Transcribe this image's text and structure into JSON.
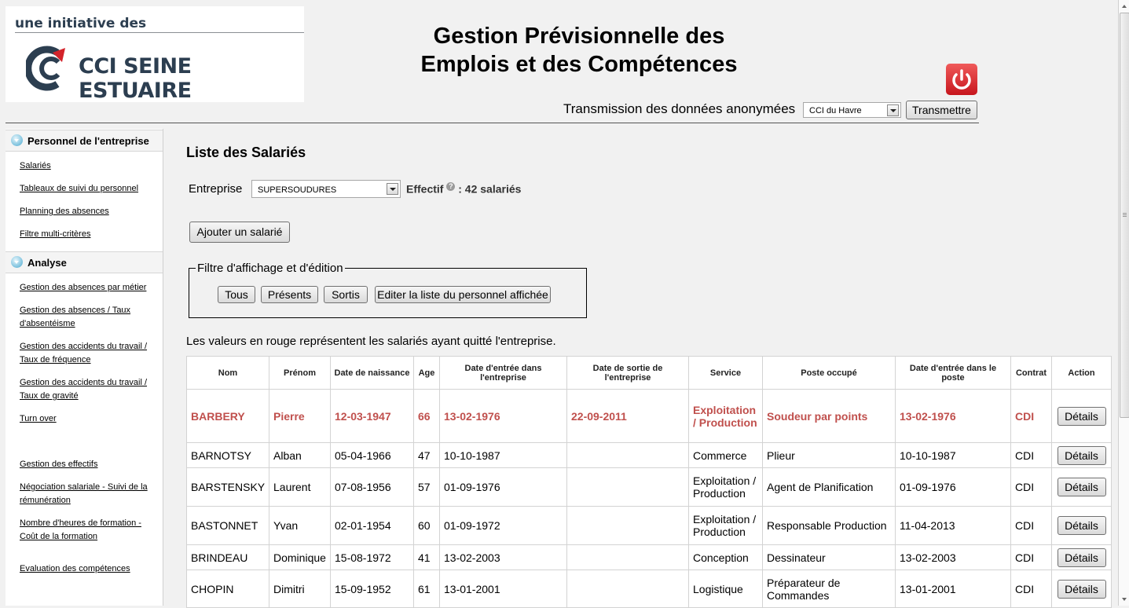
{
  "logo": {
    "tagline": "une initiative des",
    "name": "CCI SEINE ESTUAIRE"
  },
  "header": {
    "title_line1": "Gestion Prévisionnelle des",
    "title_line2": "Emplois et des Compétences",
    "transmit_label": "Transmission des données anonymées",
    "cci_select_value": "CCI du Havre",
    "transmit_button": "Transmettre"
  },
  "sidebar": {
    "section1": {
      "title": "Personnel de l'entreprise",
      "links": [
        "Salariés",
        "Tableaux de suivi du personnel",
        "Planning des absences",
        "Filtre multi-critères"
      ]
    },
    "section2": {
      "title": "Analyse",
      "links": [
        "Gestion des absences par métier",
        "Gestion des absences / Taux d'absentéisme",
        "Gestion des accidents du travail / Taux de fréquence",
        "Gestion des accidents du travail / Taux de gravité",
        "Turn over",
        "Gestion des effectifs",
        "Négociation salariale - Suivi de la rémunération",
        "Nombre d'heures de formation - Coût de la formation",
        "Evaluation des compétences"
      ]
    }
  },
  "main": {
    "title": "Liste des Salariés",
    "entreprise_label": "Entreprise",
    "entreprise_value": "SUPERSOUDURES",
    "effectif_label": "Effectif",
    "effectif_value": ": 42 salariés",
    "add_button": "Ajouter un salarié",
    "filter": {
      "legend": "Filtre d'affichage et d'édition",
      "buttons": [
        "Tous",
        "Présents",
        "Sortis",
        "Editer la liste du personnel affichée"
      ]
    },
    "note": "Les valeurs en rouge représentent les salariés ayant quitté l'entreprise."
  },
  "table": {
    "headers": [
      "Nom",
      "Prénom",
      "Date de naissance",
      "Age",
      "Date d'entrée dans l'entreprise",
      "Date de sortie de l'entreprise",
      "Service",
      "Poste occupé",
      "Date d'entrée dans le poste",
      "Contrat",
      "Action"
    ],
    "action_label": "Détails",
    "rows": [
      {
        "nom": "BARBERY",
        "prenom": "Pierre",
        "naissance": "12-03-1947",
        "age": "66",
        "entree": "13-02-1976",
        "sortie": "22-09-2011",
        "service": "Exploitation / Production",
        "poste": "Soudeur par points",
        "entree_poste": "13-02-1976",
        "contrat": "CDI",
        "left": true
      },
      {
        "nom": "BARNOTSY",
        "prenom": "Alban",
        "naissance": "05-04-1966",
        "age": "47",
        "entree": "10-10-1987",
        "sortie": "",
        "service": "Commerce",
        "poste": "Plieur",
        "entree_poste": "10-10-1987",
        "contrat": "CDI",
        "left": false
      },
      {
        "nom": "BARSTENSKY",
        "prenom": "Laurent",
        "naissance": "07-08-1956",
        "age": "57",
        "entree": "01-09-1976",
        "sortie": "",
        "service": "Exploitation / Production",
        "poste": "Agent de Planification",
        "entree_poste": "01-09-1976",
        "contrat": "CDI",
        "left": false
      },
      {
        "nom": "BASTONNET",
        "prenom": "Yvan",
        "naissance": "02-01-1954",
        "age": "60",
        "entree": "01-09-1972",
        "sortie": "",
        "service": "Exploitation / Production",
        "poste": "Responsable Production",
        "entree_poste": "11-04-2013",
        "contrat": "CDI",
        "left": false
      },
      {
        "nom": "BRINDEAU",
        "prenom": "Dominique",
        "naissance": "15-08-1972",
        "age": "41",
        "entree": "13-02-2003",
        "sortie": "",
        "service": "Conception",
        "poste": "Dessinateur",
        "entree_poste": "13-02-2003",
        "contrat": "CDI",
        "left": false
      },
      {
        "nom": "CHOPIN",
        "prenom": "Dimitri",
        "naissance": "15-09-1952",
        "age": "61",
        "entree": "13-01-2001",
        "sortie": "",
        "service": "Logistique",
        "poste": "Préparateur de Commandes",
        "entree_poste": "13-01-2001",
        "contrat": "CDI",
        "left": false
      }
    ]
  },
  "colors": {
    "left_employee": "#c0504d",
    "brand_navy": "#2c3e50",
    "power_red": "#d3232a"
  },
  "icons": {
    "power": "power-icon",
    "logo": "cci-logo-icon",
    "help": "help-icon",
    "collapse": "collapse-icon"
  }
}
